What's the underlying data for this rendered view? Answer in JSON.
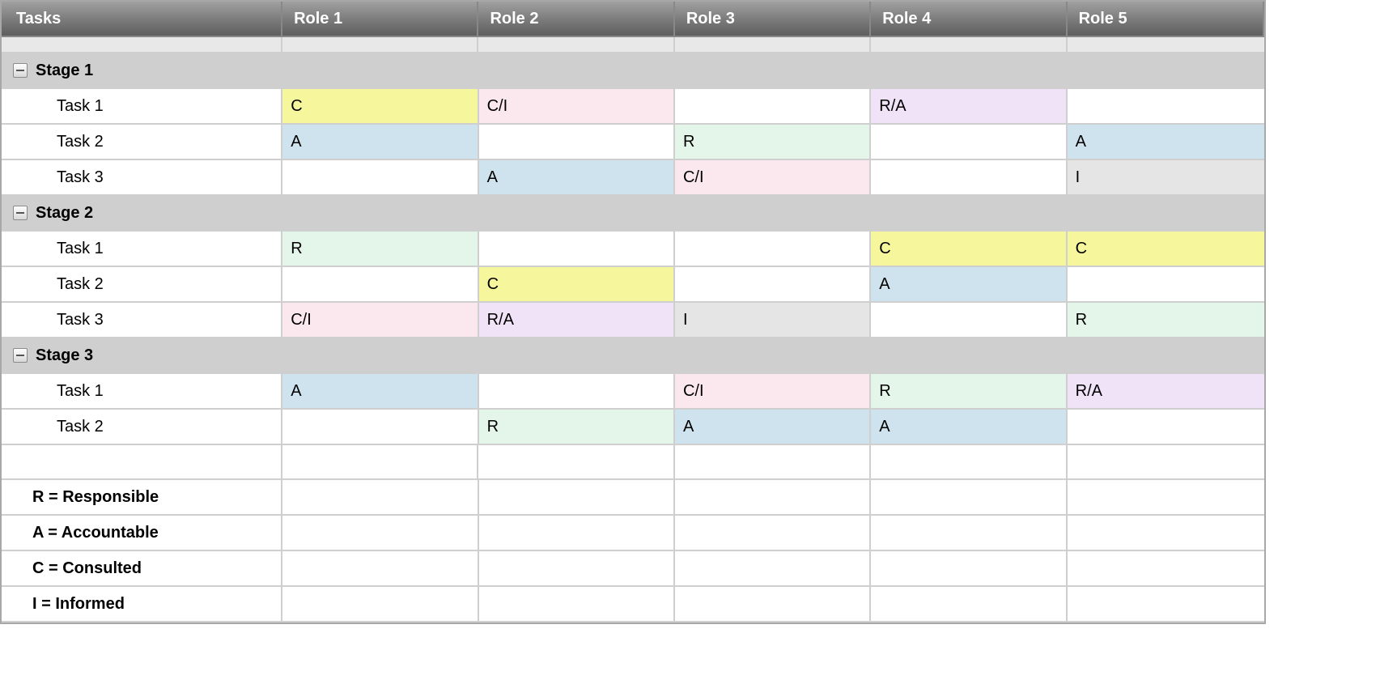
{
  "header": {
    "tasks": "Tasks",
    "roles": [
      "Role 1",
      "Role 2",
      "Role 3",
      "Role 4",
      "Role 5"
    ]
  },
  "stages": [
    {
      "label": "Stage 1",
      "tasks": [
        {
          "label": "Task 1",
          "cells": [
            "C",
            "C/I",
            "",
            "R/A",
            ""
          ]
        },
        {
          "label": "Task 2",
          "cells": [
            "A",
            "",
            "R",
            "",
            "A"
          ]
        },
        {
          "label": "Task 3",
          "cells": [
            "",
            "A",
            "C/I",
            "",
            "I"
          ]
        }
      ]
    },
    {
      "label": "Stage 2",
      "tasks": [
        {
          "label": "Task 1",
          "cells": [
            "R",
            "",
            "",
            "C",
            "C"
          ]
        },
        {
          "label": "Task 2",
          "cells": [
            "",
            "C",
            "",
            "A",
            ""
          ]
        },
        {
          "label": "Task 3",
          "cells": [
            "C/I",
            "R/A",
            "I",
            "",
            "R"
          ]
        }
      ]
    },
    {
      "label": "Stage 3",
      "tasks": [
        {
          "label": "Task 1",
          "cells": [
            "A",
            "",
            "C/I",
            "R",
            "R/A"
          ]
        },
        {
          "label": "Task 2",
          "cells": [
            "",
            "R",
            "A",
            "A",
            ""
          ]
        }
      ]
    }
  ],
  "legend": [
    "R = Responsible",
    "A = Accountable",
    "C = Consulted",
    "I = Informed"
  ],
  "colors": {
    "C": "#f6f79d",
    "C/I": "#fbe8ee",
    "R/A": "#f0e2f7",
    "A": "#cfe3ef",
    "R": "#e4f5e9",
    "I": "#e5e5e5"
  }
}
